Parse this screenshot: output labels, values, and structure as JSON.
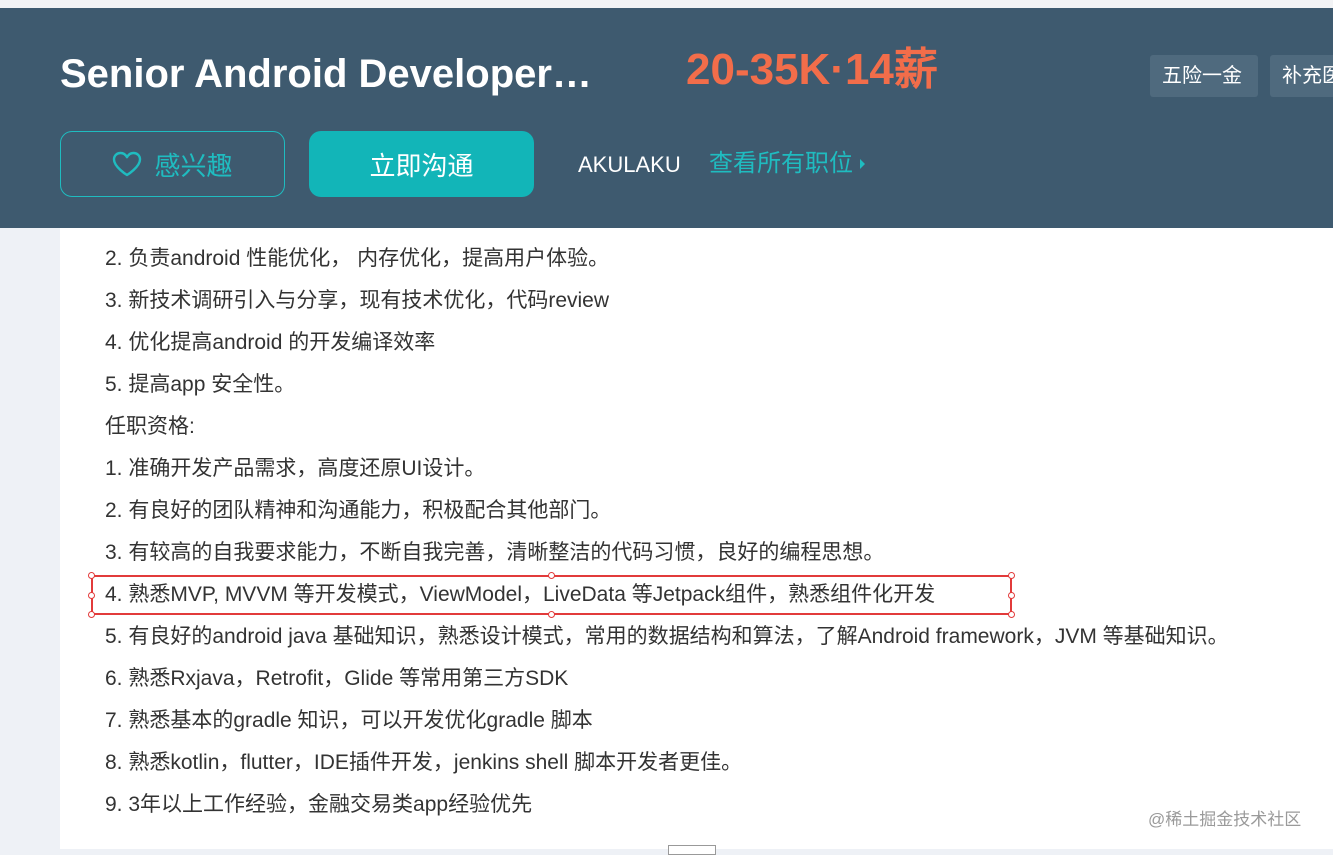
{
  "header": {
    "job_title": "Senior Android Developer…",
    "salary": "20-35K·14薪",
    "benefits": [
      "五险一金",
      "补充医"
    ],
    "interest_label": "感兴趣",
    "chat_label": "立即沟通",
    "company": "AKULAKU",
    "view_all_label": "查看所有职位"
  },
  "content": {
    "items": [
      "2. 负责android 性能优化， 内存优化，提高用户体验。",
      "3. 新技术调研引入与分享，现有技术优化，代码review",
      "4. 优化提高android 的开发编译效率",
      "5. 提高app 安全性。",
      "任职资格:",
      "1. 准确开发产品需求，高度还原UI设计。",
      "2. 有良好的团队精神和沟通能力，积极配合其他部门。",
      "3. 有较高的自我要求能力，不断自我完善，清晰整洁的代码习惯，良好的编程思想。",
      "4. 熟悉MVP, MVVM 等开发模式，ViewModel，LiveData 等Jetpack组件，熟悉组件化开发",
      "5. 有良好的android java 基础知识，熟悉设计模式，常用的数据结构和算法，了解Android framework，JVM 等基础知识。",
      "6. 熟悉Rxjava，Retrofit，Glide 等常用第三方SDK",
      "7. 熟悉基本的gradle 知识，可以开发优化gradle 脚本",
      "8. 熟悉kotlin，flutter，IDE插件开发，jenkins shell 脚本开发者更佳。",
      "9. 3年以上工作经验，金融交易类app经验优先"
    ]
  },
  "watermark": "@稀土掘金技术社区",
  "colors": {
    "header_bg": "#3e5a6f",
    "salary": "#f26d4a",
    "accent": "#12b5b8",
    "highlight": "#e23b3b"
  }
}
